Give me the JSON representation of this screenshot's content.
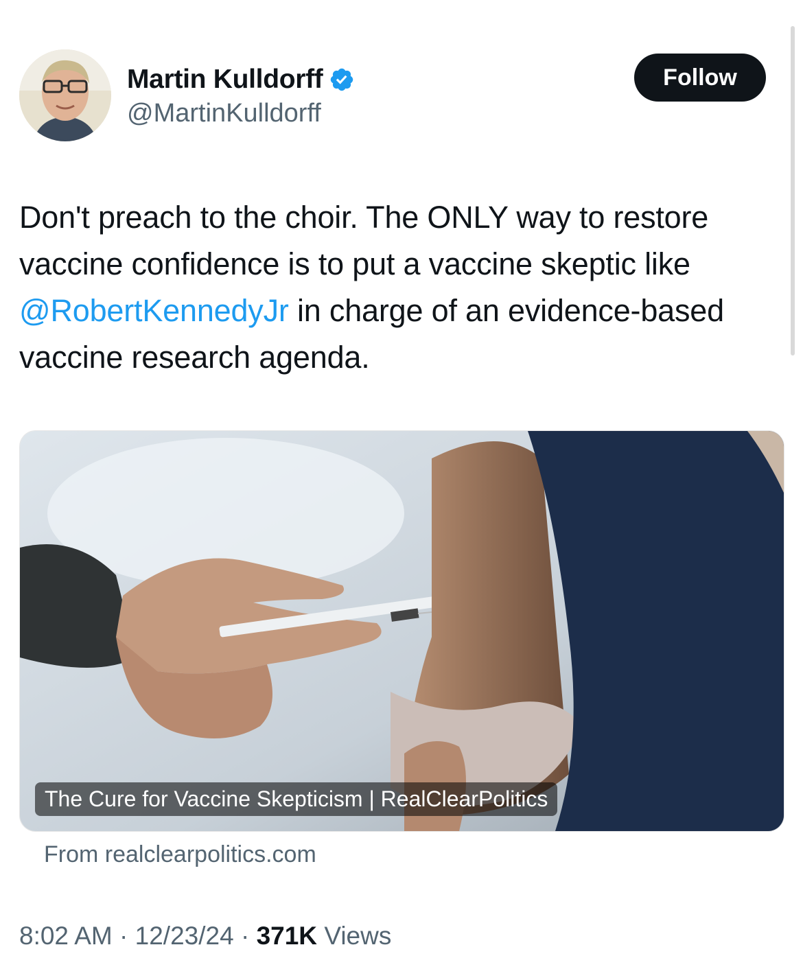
{
  "tweet": {
    "author": {
      "display_name": "Martin Kulldorff",
      "handle": "@MartinKulldorff",
      "verified": true
    },
    "follow_label": "Follow",
    "text_before_mention": "Don't preach to the choir. The ONLY way to restore vaccine confidence is to put a vaccine skeptic like ",
    "mention": "@RobertKennedyJr",
    "text_after_mention": " in charge of an evidence-based vaccine research agenda.",
    "link_card": {
      "title": "The Cure for Vaccine Skepticism | RealClearPolitics",
      "source": "From realclearpolitics.com"
    },
    "time": "8:02 AM",
    "date": "12/23/24",
    "views_count": "371K",
    "views_label": "Views",
    "separator": " · "
  },
  "colors": {
    "text": "#0f1419",
    "secondary": "#536471",
    "link": "#1d9bf0",
    "follow_bg": "#0f1419"
  },
  "icons": [
    "verified-badge-icon"
  ]
}
